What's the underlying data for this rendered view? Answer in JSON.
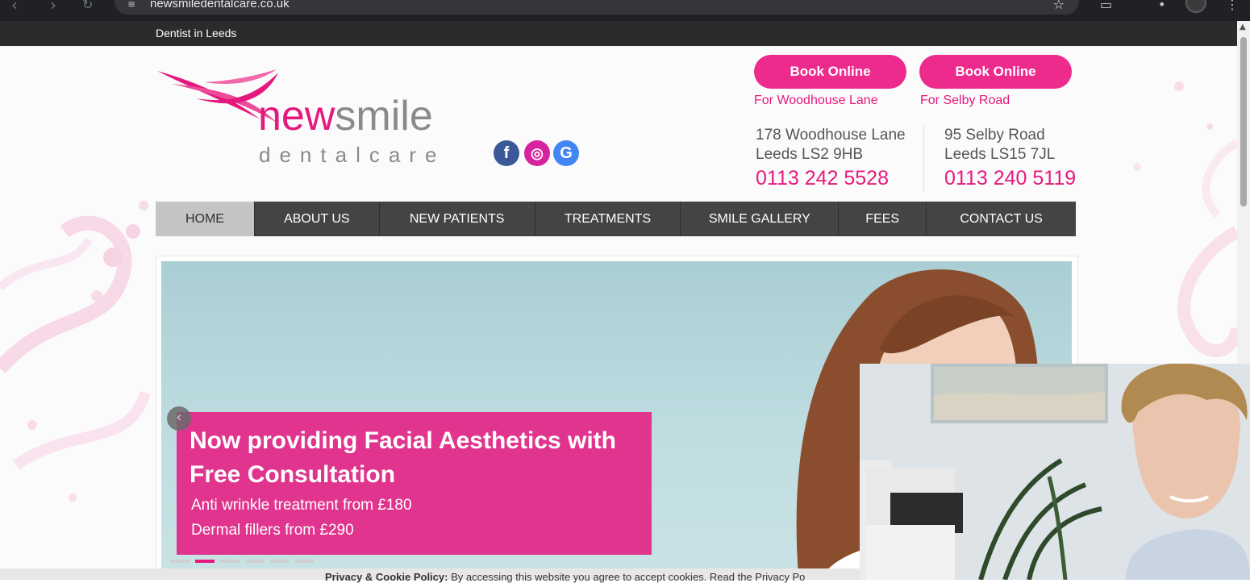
{
  "browser": {
    "url": "newsmiledentalcare.co.uk"
  },
  "topbar": {
    "text": "Dentist in Leeds"
  },
  "logo": {
    "word_new": "new",
    "word_smile": "smile",
    "tagline": "dentalcare"
  },
  "social": [
    {
      "icon": "facebook-icon",
      "glyph": "f",
      "color": "#3b5998"
    },
    {
      "icon": "instagram-icon",
      "glyph": "◎",
      "color": "#d6249f"
    },
    {
      "icon": "google-icon",
      "glyph": "G",
      "color": "#4285f4"
    }
  ],
  "booking": [
    {
      "button": "Book Online",
      "location": "For Woodhouse Lane"
    },
    {
      "button": "Book Online",
      "location": "For Selby Road"
    }
  ],
  "addresses": [
    {
      "line1": "178 Woodhouse Lane",
      "line2": "Leeds LS2 9HB",
      "phone": "0113 242 5528"
    },
    {
      "line1": "95 Selby Road",
      "line2": "Leeds LS15 7JL",
      "phone": "0113 240 5119"
    }
  ],
  "nav": {
    "items": [
      "HOME",
      "ABOUT US",
      "NEW PATIENTS",
      "TREATMENTS",
      "SMILE GALLERY",
      "FEES",
      "CONTACT US"
    ],
    "active": "HOME"
  },
  "slider": {
    "title": "Now providing Facial Aesthetics with Free Consultation",
    "line1": "Anti wrinkle treatment from £180",
    "line2": "Dermal fillers from £290",
    "prev_icon": "chevron-left-icon",
    "slide_count": 6,
    "active_slide": 2
  },
  "cookie": {
    "bold": "Privacy & Cookie Policy:",
    "text": " By accessing this website you agree to accept cookies. Read the Privacy Po"
  },
  "colors": {
    "brand_pink": "#e5197d",
    "button_pink": "#ec2b8c",
    "nav_dark": "#444444",
    "nav_active": "#c4c4c4"
  }
}
